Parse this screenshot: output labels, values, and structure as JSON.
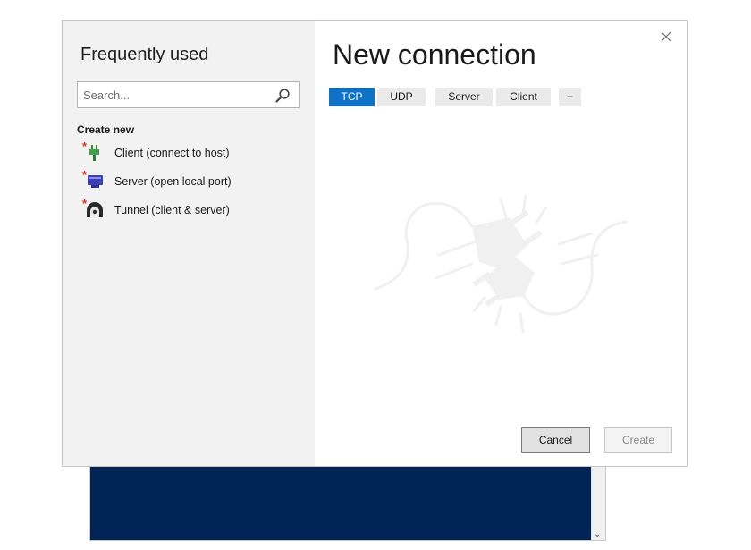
{
  "dialog": {
    "left": {
      "title": "Frequently used",
      "search_placeholder": "Search...",
      "section_heading": "Create new",
      "items": [
        {
          "label": "Client (connect to host)",
          "icon": "client-plug-icon"
        },
        {
          "label": "Server (open local port)",
          "icon": "server-port-icon"
        },
        {
          "label": "Tunnel (client & server)",
          "icon": "tunnel-icon"
        }
      ]
    },
    "main": {
      "title": "New connection",
      "tabs": [
        {
          "label": "TCP",
          "active": true
        },
        {
          "label": "UDP",
          "active": false
        },
        {
          "label": "Server",
          "active": false
        },
        {
          "label": "Client",
          "active": false
        },
        {
          "label": "+",
          "active": false
        }
      ],
      "watermark_icon": "disconnected-plug-icon"
    },
    "buttons": {
      "cancel": "Cancel",
      "create": "Create"
    }
  },
  "colors": {
    "accent": "#0e72c9",
    "console_bg": "#012456",
    "left_pane_bg": "#f2f2f2",
    "new_item_star": "#e0331c"
  }
}
